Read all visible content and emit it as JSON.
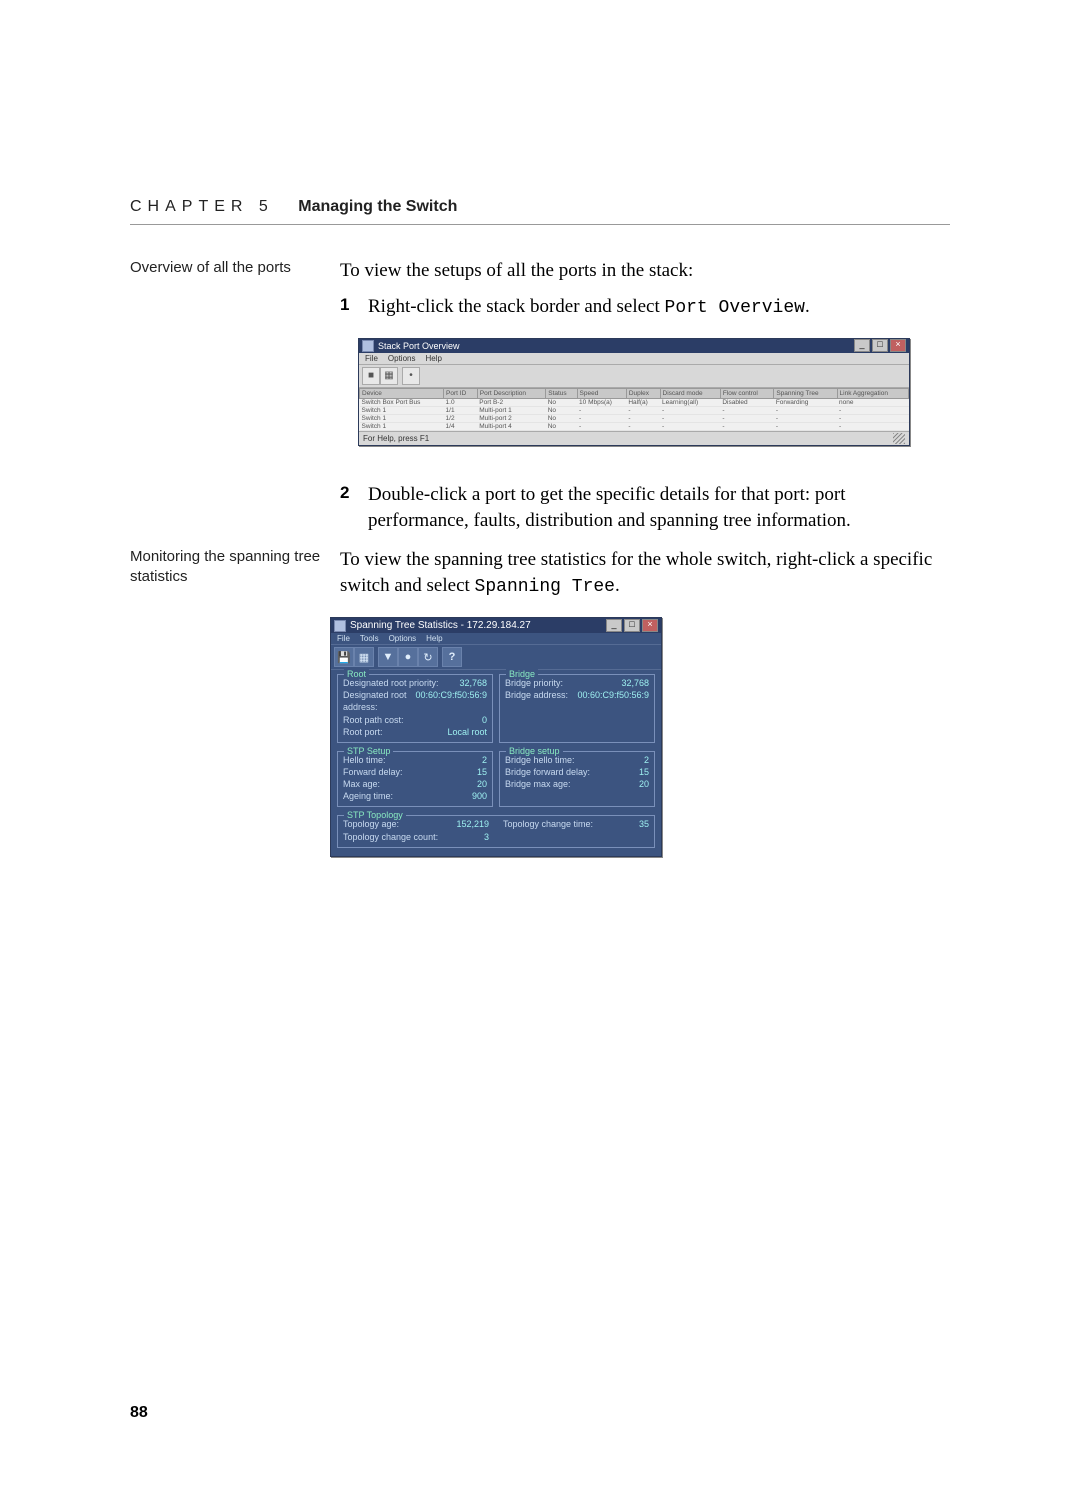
{
  "chapter": {
    "prefix": "CHAPTER 5",
    "title": "Managing the Switch"
  },
  "page_number": "88",
  "sidebar": {
    "overview": "Overview of all the ports",
    "monitoring": "Monitoring the spanning tree statistics"
  },
  "body": {
    "para1": "To view the setups of all the ports in the stack:",
    "step1": {
      "num": "1",
      "text_a": "Right-click the stack border and select ",
      "code": "Port Overview",
      "text_b": "."
    },
    "step2": {
      "num": "2",
      "text": "Double-click a port to get the specific details for that port: port performance, faults, distribution and spanning tree information."
    },
    "para2_a": "To view the spanning tree statistics for the whole switch, right-click a specific switch and select ",
    "para2_code": "Spanning Tree",
    "para2_b": "."
  },
  "port_window": {
    "title": "Stack Port Overview",
    "menu": {
      "file": "File",
      "options": "Options",
      "help": "Help"
    },
    "toolbar_icons": [
      "save-icon",
      "grid-icon",
      "dot-icon"
    ],
    "headers": [
      "Device",
      "Port ID",
      "Port Description",
      "Status",
      "Speed",
      "Duplex",
      "Discard mode",
      "Flow control",
      "Spanning Tree",
      "Link Aggregation"
    ],
    "rows": [
      {
        "device": "Switch Box Port Bus",
        "port_id": "1.0",
        "desc": "Port B-2",
        "status": "No",
        "speed": "10 Mbps(a)",
        "duplex": "Half(a)",
        "discard": "Learning(all)",
        "flow": "Disabled",
        "stp": "Forwarding",
        "lag": "none"
      },
      {
        "device": "Switch 1",
        "port_id": "1/1",
        "desc": "Multi-port 1",
        "status": "No",
        "speed": "-",
        "duplex": "-",
        "discard": "-",
        "flow": "-",
        "stp": "-",
        "lag": "-"
      },
      {
        "device": "Switch 1",
        "port_id": "1/2",
        "desc": "Multi-port 2",
        "status": "No",
        "speed": "-",
        "duplex": "-",
        "discard": "-",
        "flow": "-",
        "stp": "-",
        "lag": "-"
      },
      {
        "device": "Switch 1",
        "port_id": "1/4",
        "desc": "Multi-port 4",
        "status": "No",
        "speed": "-",
        "duplex": "-",
        "discard": "-",
        "flow": "-",
        "stp": "-",
        "lag": "-"
      }
    ],
    "status_bar": "For Help, press F1"
  },
  "stp_window": {
    "title": "Spanning Tree Statistics - 172.29.184.27",
    "menu": {
      "file": "File",
      "tools": "Tools",
      "options": "Options",
      "help": "Help"
    },
    "root": {
      "title": "Root",
      "designated_root_priority": {
        "k": "Designated root priority:",
        "v": "32,768"
      },
      "designated_root_address": {
        "k": "Designated root address:",
        "v": "00:60:C9:f50:56:9"
      },
      "root_path_cost": {
        "k": "Root path cost:",
        "v": "0"
      },
      "root_port": {
        "k": "Root port:",
        "v": "Local root"
      }
    },
    "bridge": {
      "title": "Bridge",
      "bridge_priority": {
        "k": "Bridge priority:",
        "v": "32,768"
      },
      "bridge_address": {
        "k": "Bridge address:",
        "v": "00:60:C9:f50:56:9"
      }
    },
    "stp_setup": {
      "title": "STP Setup",
      "hello_time": {
        "k": "Hello time:",
        "v": "2"
      },
      "forward_delay": {
        "k": "Forward delay:",
        "v": "15"
      },
      "max_age": {
        "k": "Max age:",
        "v": "20"
      },
      "ageing_time": {
        "k": "Ageing time:",
        "v": "900"
      }
    },
    "bridge_setup": {
      "title": "Bridge setup",
      "bridge_hello_time": {
        "k": "Bridge hello time:",
        "v": "2"
      },
      "bridge_forward_delay": {
        "k": "Bridge forward delay:",
        "v": "15"
      },
      "bridge_max_age": {
        "k": "Bridge max age:",
        "v": "20"
      }
    },
    "stp_topology": {
      "title": "STP Topology",
      "topology_age": {
        "k": "Topology age:",
        "v": "152,219"
      },
      "topology_change_count": {
        "k": "Topology change count:",
        "v": "3"
      },
      "topology_change_time": {
        "k": "Topology change time:",
        "v": "35"
      }
    }
  }
}
